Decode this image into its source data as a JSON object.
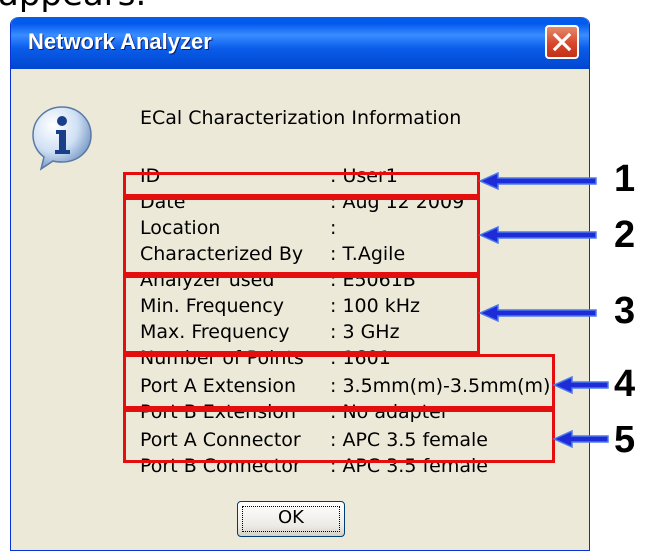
{
  "clipped_caption": "appears.",
  "dialog": {
    "title": "Network Analyzer",
    "heading": "ECal Characterization Information",
    "rows": [
      {
        "label": "ID",
        "value": "User1"
      },
      {
        "label": "Date",
        "value": "Aug 12 2009"
      },
      {
        "label": "Location",
        "value": ""
      },
      {
        "label": "Characterized By",
        "value": "T.Agile"
      },
      {
        "label": "Analyzer used",
        "value": "E5061B"
      },
      {
        "label": "Min. Frequency",
        "value": "100 kHz"
      },
      {
        "label": "Max. Frequency",
        "value": "3 GHz"
      },
      {
        "label": "Number of Points",
        "value": "1601"
      },
      {
        "label": "Port A Extension",
        "value": "3.5mm(m)-3.5mm(m)"
      },
      {
        "label": "Port B Extension",
        "value": "No adapter"
      },
      {
        "label": "Port A Connector",
        "value": "APC 3.5 female"
      },
      {
        "label": "Port B Connector",
        "value": "APC 3.5 female"
      }
    ],
    "ok_label": "OK"
  },
  "annotations": [
    "1",
    "2",
    "3",
    "4",
    "5"
  ],
  "colors": {
    "highlight": "#e40e0e",
    "arrow": "#1d2bd8",
    "title_bar": "#0058ee"
  }
}
